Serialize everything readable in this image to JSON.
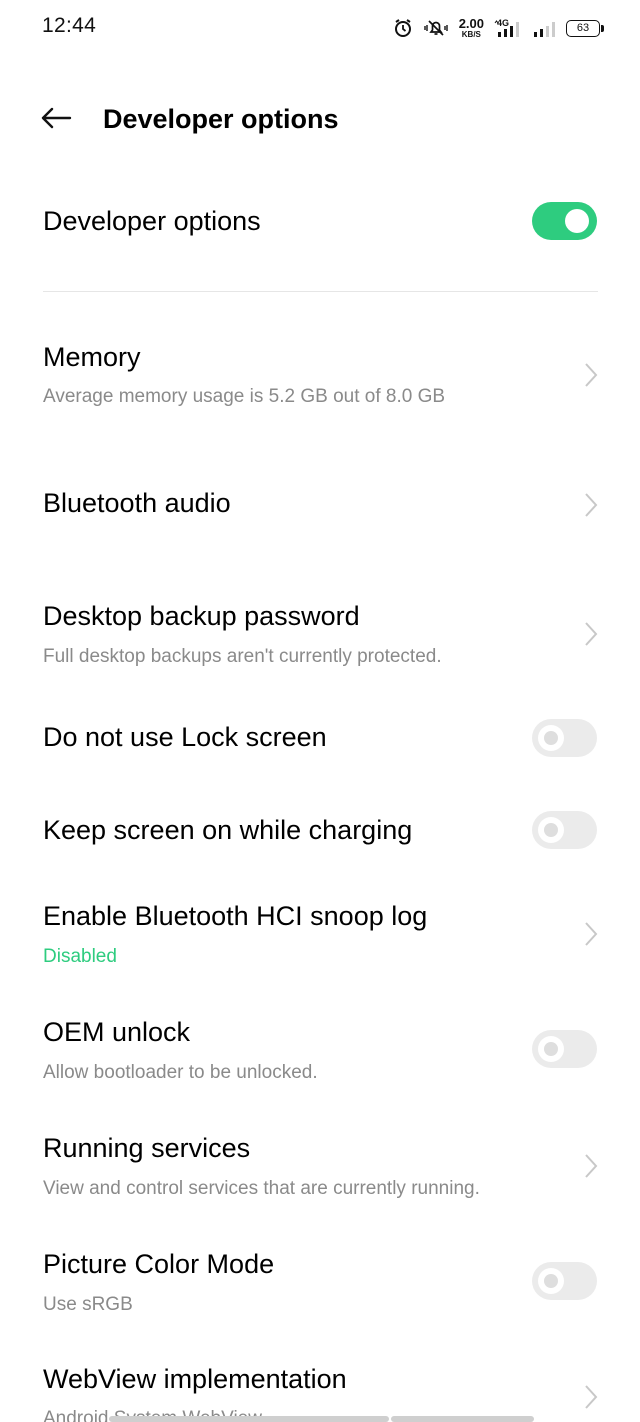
{
  "status_bar": {
    "time": "12:44",
    "icons": [
      "alarm-icon",
      "mute-icon",
      "net-speed",
      "4g-signal-icon",
      "signal-icon",
      "battery-icon"
    ],
    "net_speed_value": "2.00",
    "net_speed_unit": "KB/S",
    "network_type": "4G",
    "battery_level": "63"
  },
  "header": {
    "back_icon": "arrow-left-icon",
    "title": "Developer options"
  },
  "master_switch": {
    "label": "Developer options",
    "enabled": true
  },
  "colors": {
    "accent": "#2ecc7f",
    "toggle_off": "#ebebeb",
    "secondary_text": "#8a8a8a"
  },
  "items": [
    {
      "title": "Memory",
      "subtitle": "Average memory usage is 5.2 GB out of 8.0 GB",
      "control": "chevron"
    },
    {
      "title": "Bluetooth audio",
      "subtitle": "",
      "control": "chevron"
    },
    {
      "title": "Desktop backup password",
      "subtitle": "Full desktop backups aren't currently protected.",
      "control": "chevron"
    },
    {
      "title": "Do not use Lock screen",
      "subtitle": "",
      "control": "toggle",
      "enabled": false
    },
    {
      "title": "Keep screen on while charging",
      "subtitle": "",
      "control": "toggle",
      "enabled": false
    },
    {
      "title": "Enable Bluetooth HCI snoop log",
      "subtitle": "Disabled",
      "subtitle_accent": true,
      "control": "chevron"
    },
    {
      "title": "OEM unlock",
      "subtitle": "Allow bootloader to be unlocked.",
      "control": "toggle",
      "enabled": false
    },
    {
      "title": "Running services",
      "subtitle": "View and control services that are currently running.",
      "control": "chevron"
    },
    {
      "title": "Picture Color Mode",
      "subtitle": "Use sRGB",
      "control": "toggle",
      "enabled": false
    },
    {
      "title": "WebView implementation",
      "subtitle": "Android System WebView",
      "control": "chevron"
    }
  ]
}
